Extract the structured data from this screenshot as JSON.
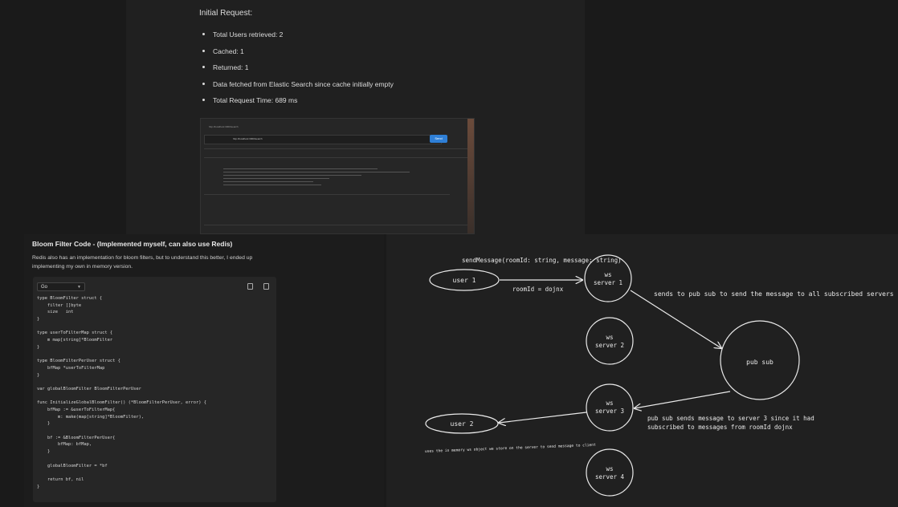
{
  "top_doc": {
    "heading": "Initial Request:",
    "bullets": [
      "Total Users retrieved: 2",
      "Cached: 1",
      "Returned: 1",
      "Data fetched from Elastic Search since cache initially empty",
      "Total Request Time: 689 ms"
    ],
    "postman": {
      "url": "http://localhost:3000/search",
      "send_label": "Send"
    }
  },
  "bloom": {
    "title": "Bloom Filter Code - (Implemented myself, can also use Redis)",
    "description": "Redis also has an implementation for bloom filters, but to understand this better, I ended up implementing my own in memory version.",
    "language": "Go",
    "code_lines": [
      "type BloomFilter struct {",
      "    filter []byte",
      "    size   int",
      "}",
      "",
      "type userToFilterMap struct {",
      "    m map[string]*BloomFilter",
      "}",
      "",
      "type BloomFilterPerUser struct {",
      "    bfMap *userToFilterMap",
      "}",
      "",
      "var globalBloomFilter BloomFilterPerUser",
      "",
      "func InitializeGlobalBloomFilter() (*BloomFilterPerUser, error) {",
      "    bfMap := &userToFilterMap{",
      "        m: make(map[string]*BloomFilter),",
      "    }",
      "",
      "    bf := &BloomFilterPerUser{",
      "        bfMap: bfMap,",
      "    }",
      "",
      "    globalBloomFilter = *bf",
      "",
      "    return bf, nil",
      "}"
    ]
  },
  "diagram": {
    "top_label": "sendMessage(roomId: string, message: string)",
    "user1": "user 1",
    "room_label": "roomId = dojnx",
    "server1": [
      "ws",
      "server 1"
    ],
    "server2": [
      "ws",
      "server 2"
    ],
    "server3": [
      "ws",
      "server 3"
    ],
    "server4": [
      "ws",
      "server 4"
    ],
    "pubsub": "pub sub",
    "send_label": "sends to pub sub to send the message to all subscribed servers",
    "pubsub_label_1": "pub sub sends message to server 3 since it had",
    "pubsub_label_2": "subscribed to messages from roomId dojnx",
    "user2": "user 2",
    "memory_label": "uses the in memory ws object we store on the server to send message to client"
  }
}
